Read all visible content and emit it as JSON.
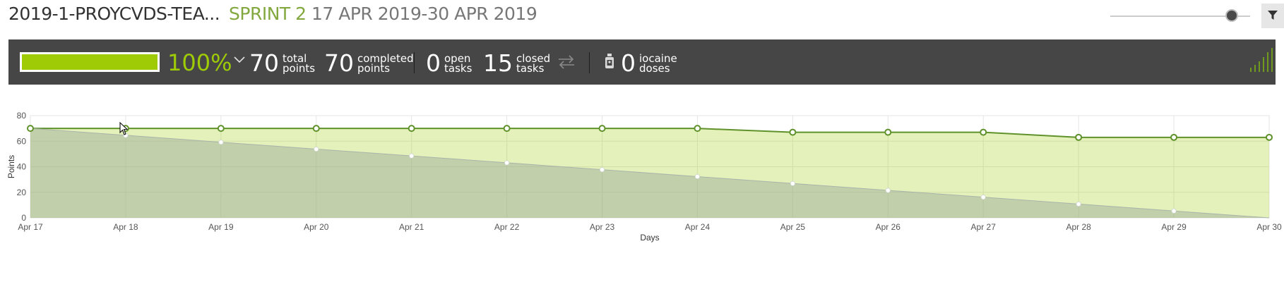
{
  "header": {
    "title": "2019-1-PROYCVDS-TEA...",
    "sprint_name": "SPRINT 2",
    "sprint_dates": "17 APR 2019-30 APR 2019",
    "zoom_level": 0.87
  },
  "stats": {
    "progress": 1.0,
    "percent": "100%",
    "total_points": "70",
    "total_label_1": "total",
    "total_label_2": "points",
    "completed_points": "70",
    "completed_label_1": "completed",
    "completed_label_2": "points",
    "open_tasks": "0",
    "open_label_1": "open",
    "open_label_2": "tasks",
    "closed_tasks": "15",
    "closed_label_1": "closed",
    "closed_label_2": "tasks",
    "iocaine": "0",
    "iocaine_label_1": "iocaine",
    "iocaine_label_2": "doses"
  },
  "colors": {
    "accent": "#9ecb06",
    "stats_bg": "#464646",
    "sprint_name": "#83a83f",
    "line": "#5f922a"
  },
  "icons": [
    "filter-icon",
    "chevron-down-icon",
    "swap-arrows-icon",
    "iocaine-bottle-icon",
    "signal-bars-icon",
    "mouse-cursor-icon"
  ],
  "chart_data": {
    "type": "area",
    "categories": [
      "Apr 17",
      "Apr 18",
      "Apr 19",
      "Apr 20",
      "Apr 21",
      "Apr 22",
      "Apr 23",
      "Apr 24",
      "Apr 25",
      "Apr 26",
      "Apr 27",
      "Apr 28",
      "Apr 29",
      "Apr 30"
    ],
    "series": [
      {
        "values": [
          70,
          70,
          70,
          70,
          70,
          70,
          70,
          70,
          67,
          67,
          67,
          63,
          63,
          63
        ]
      },
      {
        "values": [
          70,
          64.6,
          59.2,
          53.8,
          48.5,
          43.1,
          37.7,
          32.3,
          26.9,
          21.5,
          16.2,
          10.8,
          5.4,
          0
        ]
      }
    ],
    "xlabel": "Days",
    "ylabel": "Points",
    "ylim": [
      0,
      80
    ],
    "yticks": [
      "0",
      "20",
      "40",
      "60",
      "80"
    ],
    "grid": true
  }
}
